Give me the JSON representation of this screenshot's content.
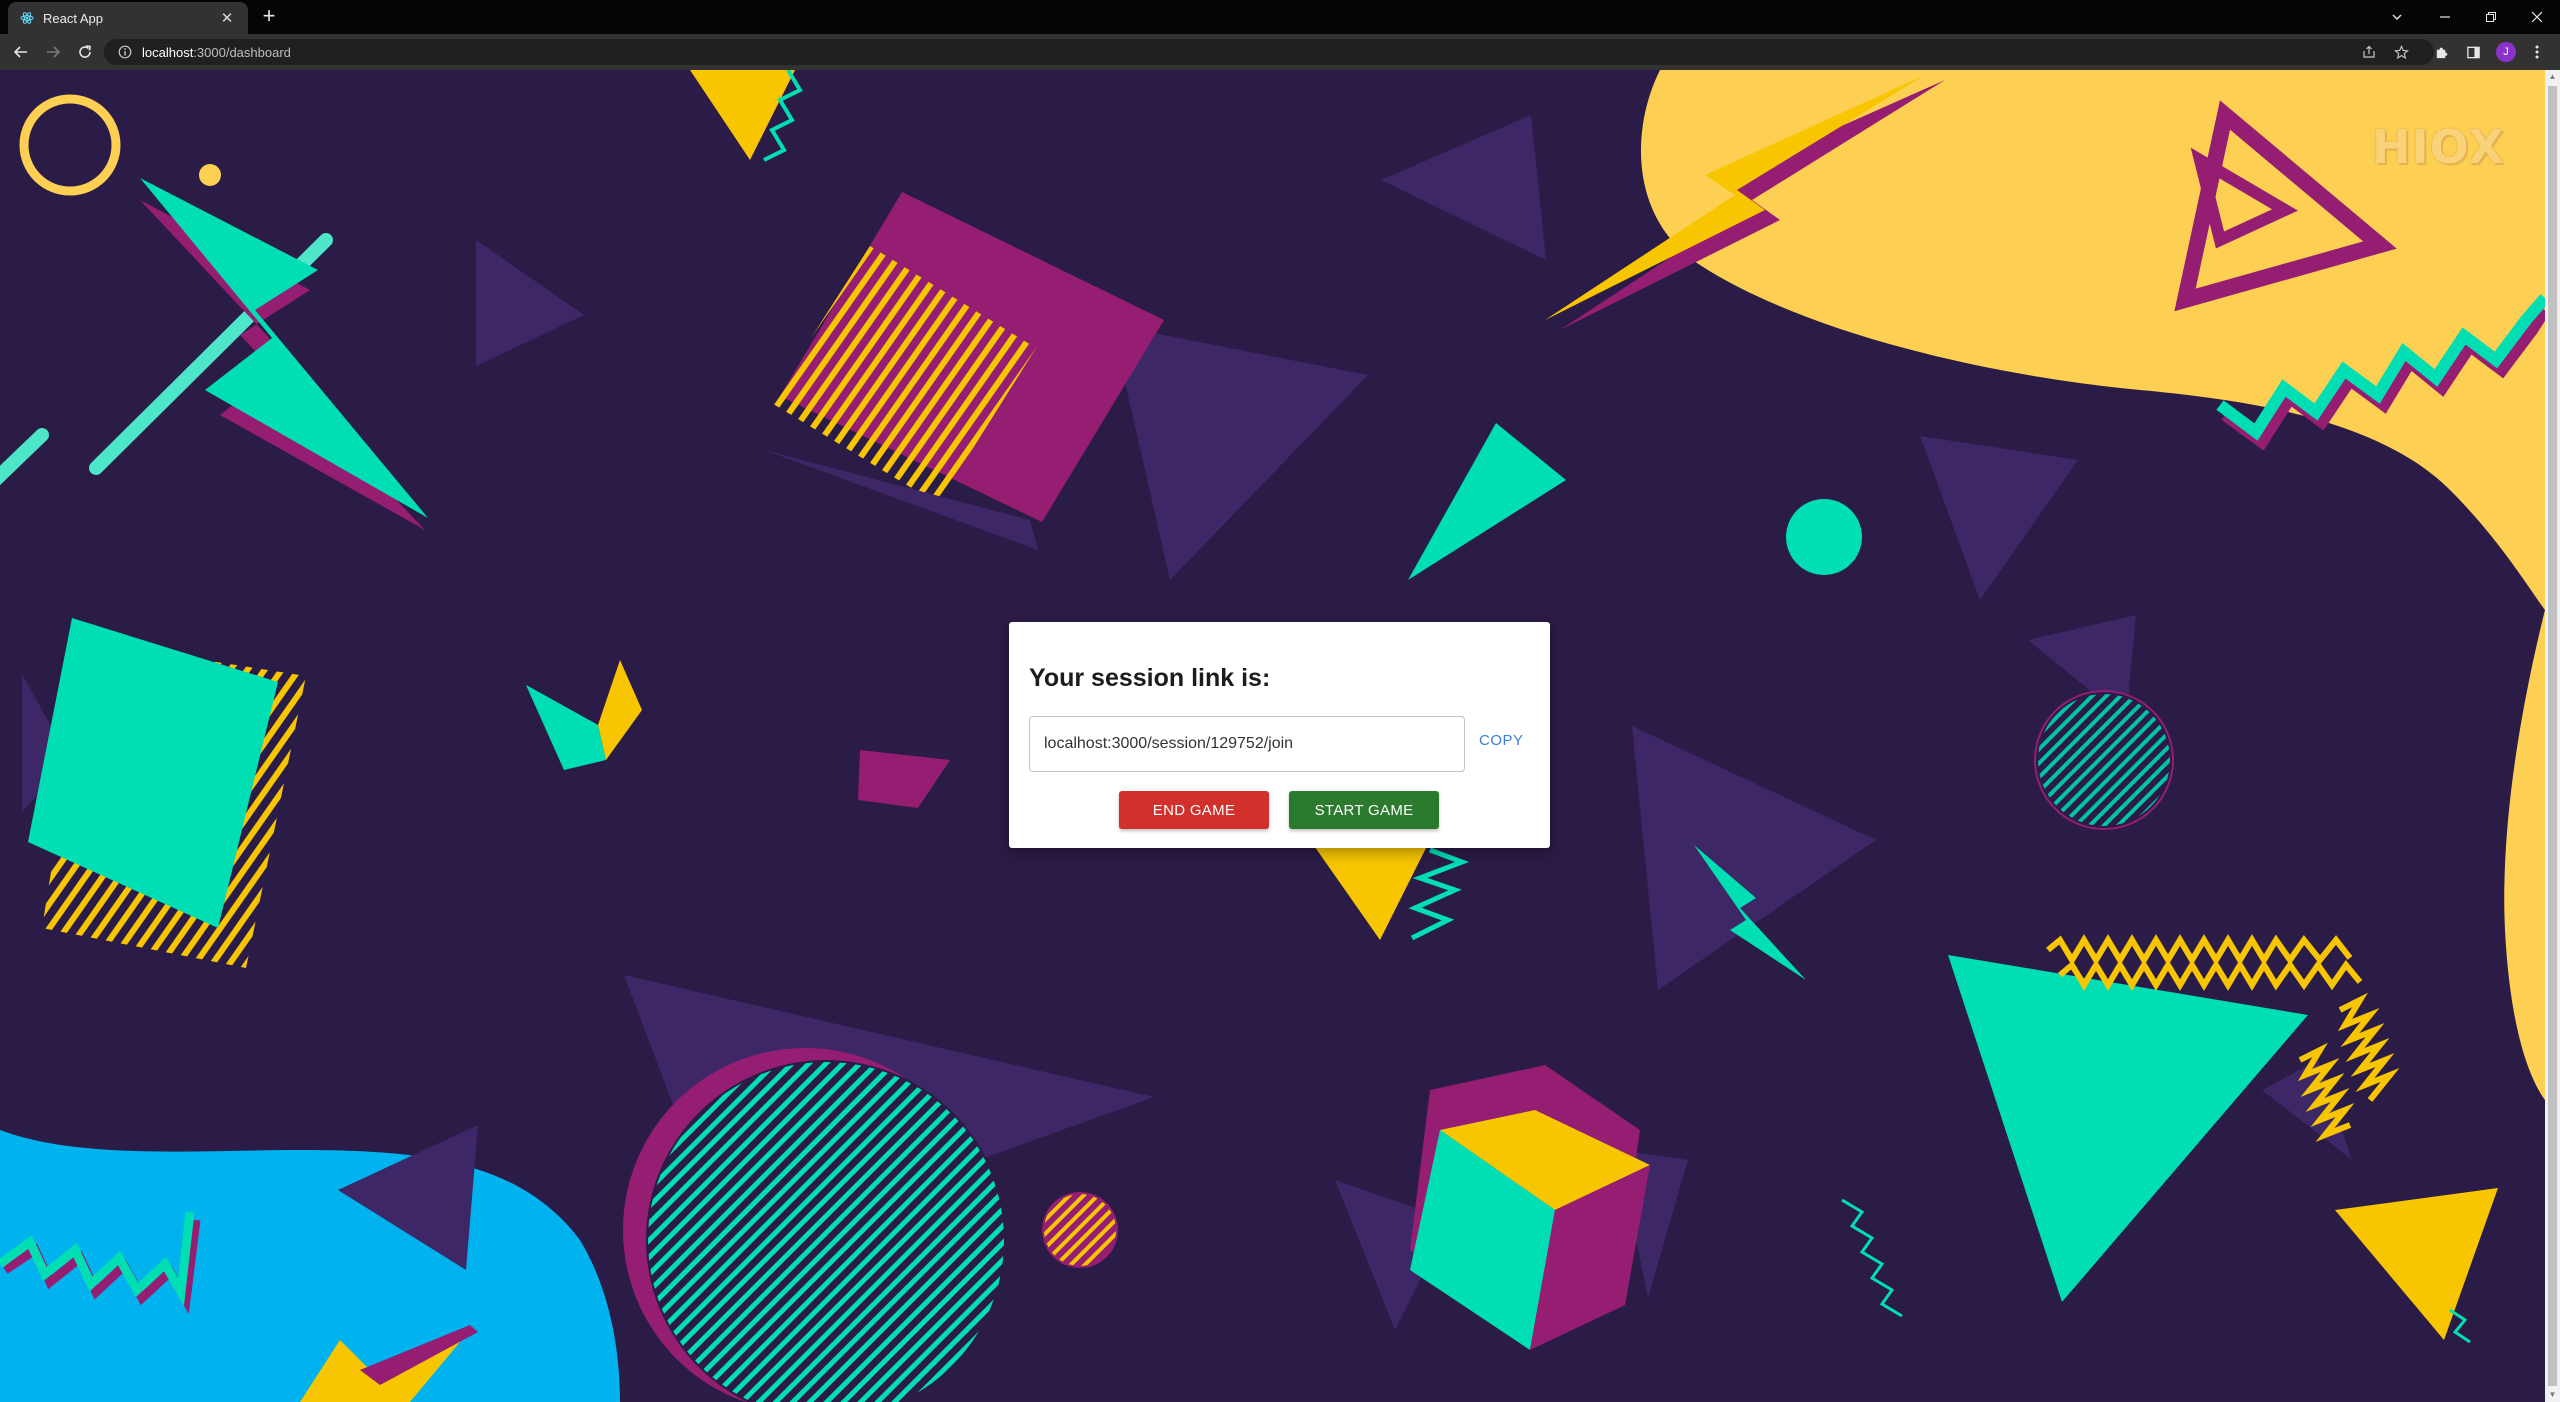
{
  "browser": {
    "tab_title": "React App",
    "url_host": "localhost",
    "url_rest": ":3000/dashboard",
    "profile_initial": "J"
  },
  "brand": {
    "logo_text": "HIOX"
  },
  "modal": {
    "title": "Your session link is:",
    "session_link": "localhost:3000/session/129752/join",
    "copy_label": "COPY",
    "end_game_label": "END GAME",
    "start_game_label": "START GAME"
  },
  "colors": {
    "background": "#2b1b47",
    "yellow": "#f7c600",
    "magenta": "#951d72",
    "teal": "#00dfb4",
    "purple_shape": "#3d2767",
    "sky_blue": "#00b2ee",
    "end_button": "#d2302b",
    "start_button": "#2b7a2e",
    "copy_link": "#3f7fd1"
  }
}
